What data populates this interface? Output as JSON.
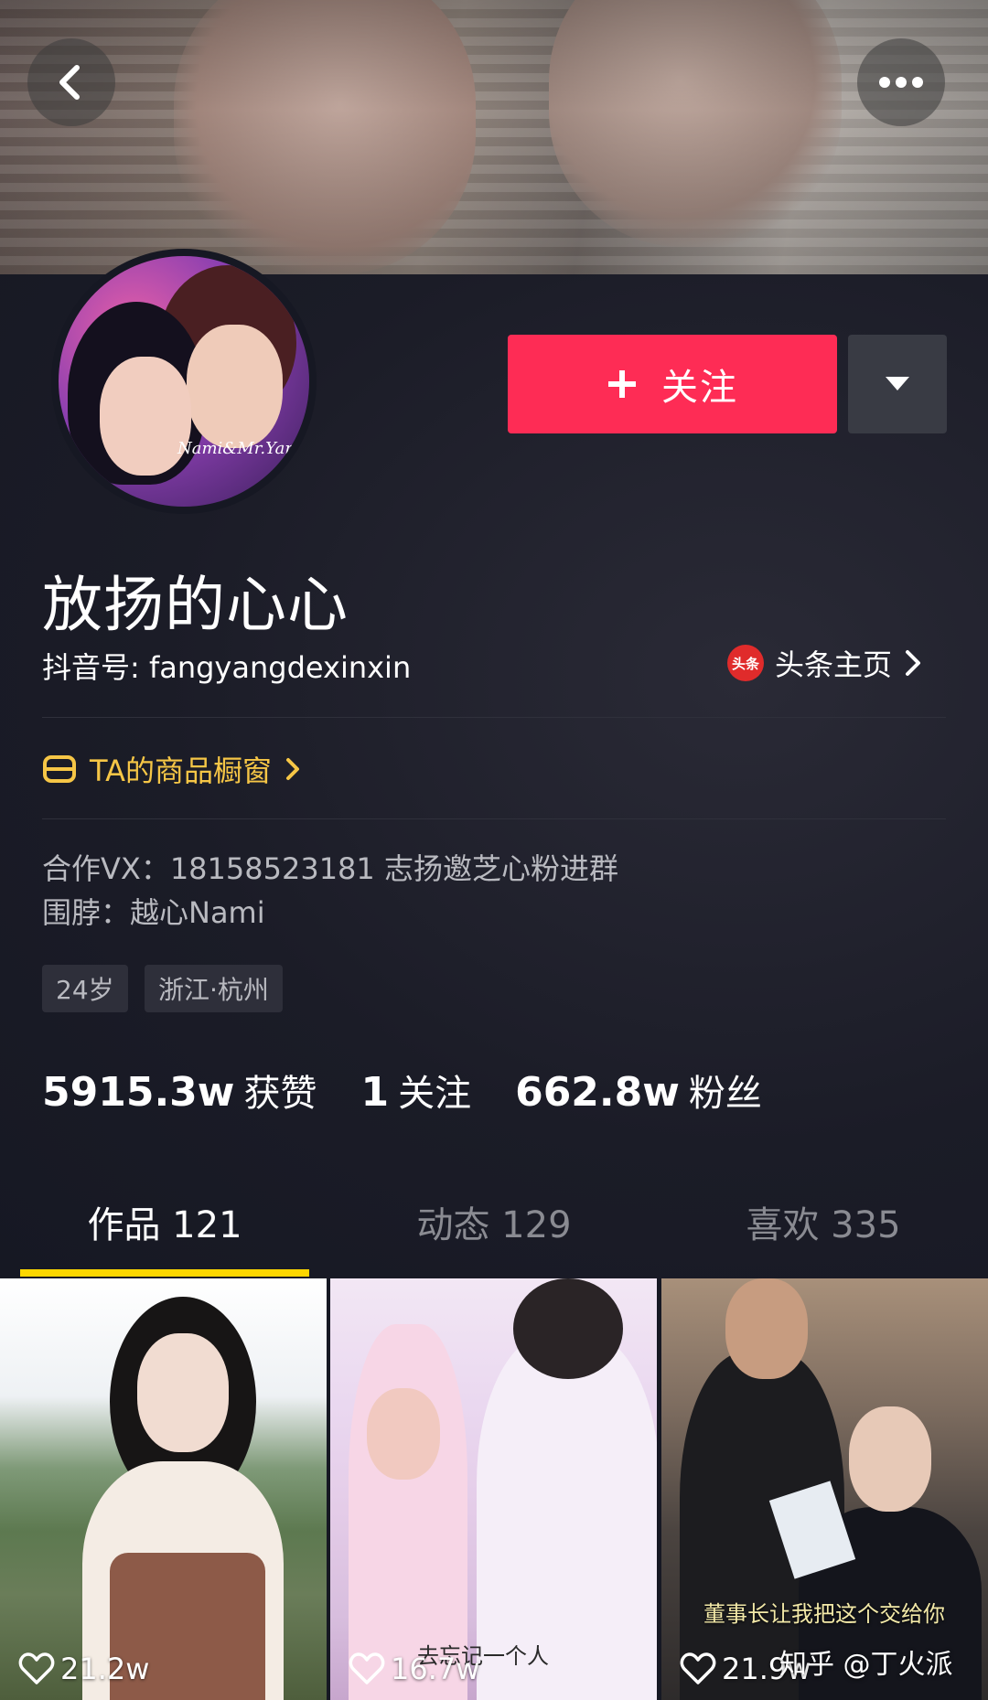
{
  "header": {
    "back_icon": "chevron-left-icon",
    "more_icon": "more-dots-icon"
  },
  "profile": {
    "name": "放扬的心心",
    "douyin_id": "抖音号: fangyangdexinxin",
    "avatar_signature": "Nami&Mr.Yang",
    "follow_label": "关注",
    "toutiao_logo": "头条",
    "toutiao_label": "头条主页",
    "shop_label": "TA的商品橱窗",
    "bio_line1": "合作VX：18158523181 志扬邀芝心粉进群",
    "bio_line2": "围脖：越心Nami",
    "tags": [
      "24岁",
      "浙江·杭州"
    ],
    "stats": {
      "likes_value": "5915.3w",
      "likes_label": "获赞",
      "following_value": "1",
      "following_label": "关注",
      "followers_value": "662.8w",
      "followers_label": "粉丝"
    }
  },
  "tabs": [
    {
      "label": "作品 121",
      "active": true
    },
    {
      "label": "动态 129",
      "active": false
    },
    {
      "label": "喜欢 335",
      "active": false
    }
  ],
  "videos": [
    {
      "likes": "21.2w",
      "caption": ""
    },
    {
      "likes": "16.7w",
      "caption": "去忘记一个人"
    },
    {
      "likes": "21.9w",
      "caption": "董事长让我把这个交给你"
    }
  ],
  "watermark": "知乎 @丁火派",
  "colors": {
    "background": "#161823",
    "follow_button": "#fe2c55",
    "shop_accent": "#f6c646",
    "tab_indicator": "#fdd700"
  }
}
